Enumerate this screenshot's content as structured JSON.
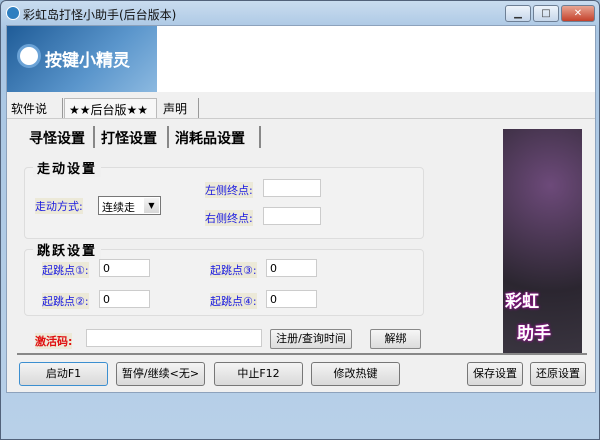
{
  "window": {
    "title": "彩虹岛打怪小助手(后台版本)",
    "minimize": "▁",
    "maximize": "□",
    "close": "✕"
  },
  "banner": {
    "logo_text": "按键小精灵"
  },
  "tabs": [
    "软件说明",
    "★★后台版★★",
    "声明"
  ],
  "inner_tabs": [
    "寻怪设置",
    "打怪设置",
    "消耗品设置"
  ],
  "walk": {
    "title": "走动设置",
    "mode_label": "走动方式:",
    "mode_value": "连续走",
    "left_label": "左侧终点:",
    "left_value": "",
    "right_label": "右侧终点:",
    "right_value": ""
  },
  "jump": {
    "title": "跳跃设置",
    "points": [
      {
        "label": "起跳点①:",
        "value": "0"
      },
      {
        "label": "起跳点②:",
        "value": "0"
      },
      {
        "label": "起跳点③:",
        "value": "0"
      },
      {
        "label": "起跳点④:",
        "value": "0"
      }
    ]
  },
  "activation": {
    "label": "激活码:",
    "value": "",
    "register": "注册/查询时间",
    "unbind": "解绑"
  },
  "picture": {
    "line1": "彩虹",
    "line2": "助手"
  },
  "buttons": {
    "start": "启动F1",
    "pause": "暂停/继续<无>",
    "stop": "中止F12",
    "hotkey": "修改热键",
    "save": "保存设置",
    "restore": "还原设置"
  }
}
